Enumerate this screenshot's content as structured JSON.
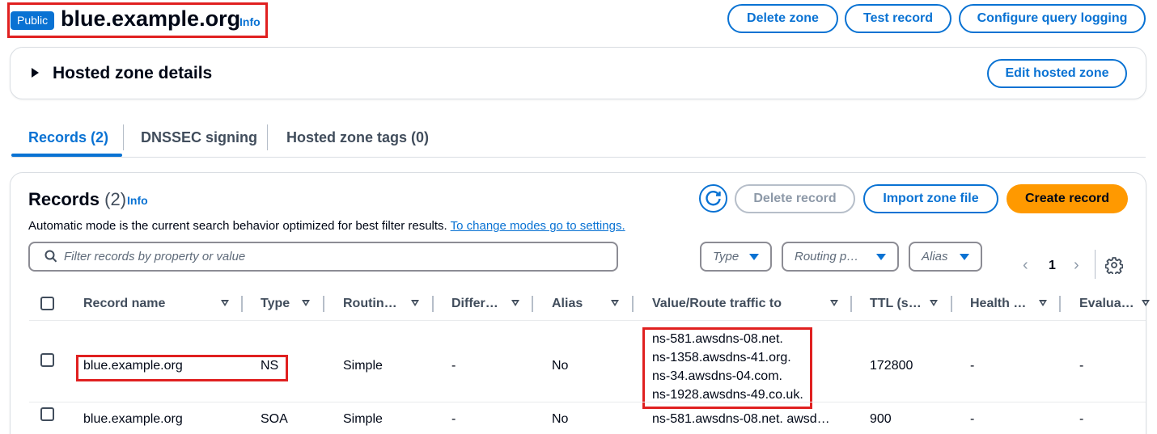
{
  "header": {
    "badge": "Public",
    "zone_name": "blue.example.org",
    "info_label": "Info",
    "buttons": {
      "delete_zone": "Delete zone",
      "test_record": "Test record",
      "configure_query_logging": "Configure query logging"
    }
  },
  "hosted_zone_details": {
    "title": "Hosted zone details",
    "edit_button": "Edit hosted zone"
  },
  "tabs": [
    {
      "label": "Records (2)",
      "active": true
    },
    {
      "label": "DNSSEC signing",
      "active": false
    },
    {
      "label": "Hosted zone tags (0)",
      "active": false
    }
  ],
  "records_panel": {
    "title": "Records",
    "count": "(2)",
    "info_label": "Info",
    "mode_text": "Automatic mode is the current search behavior optimized for best filter results.",
    "mode_link": "To change modes go to settings.",
    "buttons": {
      "delete_record": "Delete record",
      "import_zone_file": "Import zone file",
      "create_record": "Create record"
    },
    "search_placeholder": "Filter records by property or value",
    "filters": {
      "type": "Type",
      "routing_policy": "Routing p…",
      "alias": "Alias"
    },
    "pagination": {
      "current_page": "1"
    }
  },
  "table": {
    "columns": [
      "Record name",
      "Type",
      "Routin…",
      "Differ…",
      "Alias",
      "Value/Route traffic to",
      "TTL (s…",
      "Health …",
      "Evalua…"
    ],
    "rows": [
      {
        "record_name": "blue.example.org",
        "type": "NS",
        "routing": "Simple",
        "differentiator": "-",
        "alias": "No",
        "values": [
          "ns-581.awsdns-08.net.",
          "ns-1358.awsdns-41.org.",
          "ns-34.awsdns-04.com.",
          "ns-1928.awsdns-49.co.uk."
        ],
        "ttl": "172800",
        "health": "-",
        "evaluate": "-"
      },
      {
        "record_name": "blue.example.org",
        "type": "SOA",
        "routing": "Simple",
        "differentiator": "-",
        "alias": "No",
        "values": [
          "ns-581.awsdns-08.net. awsd…"
        ],
        "ttl": "900",
        "health": "-",
        "evaluate": "-"
      }
    ]
  },
  "colors": {
    "accent": "#0972d3",
    "primary_button": "#ff9900",
    "annotation_highlight": "#e02020"
  },
  "icons": [
    "refresh-icon",
    "search-icon",
    "filter-caret-icon",
    "chevron-left-icon",
    "chevron-right-icon",
    "settings-gear-icon",
    "sort-caret-icon",
    "caret-right-icon"
  ]
}
